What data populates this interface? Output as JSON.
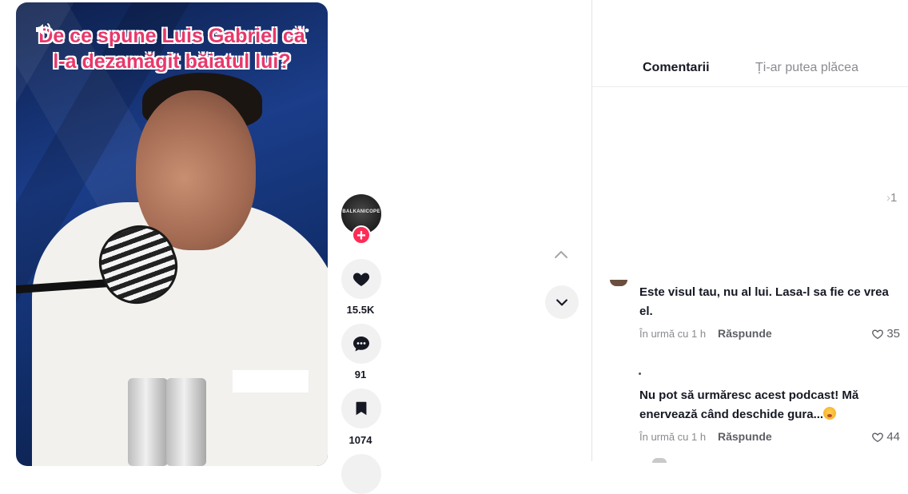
{
  "video": {
    "caption_line1": "De ce spune Luis Gabriel că",
    "caption_line2": "l-a dezamăgit băiatul lui?"
  },
  "creator": {
    "avatar_text": "BALKANICOPE"
  },
  "actions": {
    "likes": "15.5K",
    "comments": "91",
    "saves": "1074"
  },
  "tabs": [
    {
      "label": "Comentarii"
    },
    {
      "label": "Ți-ar putea plăcea"
    }
  ],
  "partial_reply_count": "1",
  "comments": [
    {
      "text": "Este visul tau, nu al lui. Lasa-l sa fie ce vrea el.",
      "time": "În urmă cu 1 h",
      "reply_label": "Răspunde",
      "likes": "35"
    },
    {
      "text": "Nu pot să urmăresc acest podcast! Mă enervează când deschide gura...",
      "time": "În urmă cu 1 h",
      "reply_label": "Răspunde",
      "likes": "44"
    }
  ],
  "colors": {
    "accent": "#fe2c55",
    "caption": "#e8386b",
    "text": "#161823",
    "muted": "#8a8b91"
  }
}
